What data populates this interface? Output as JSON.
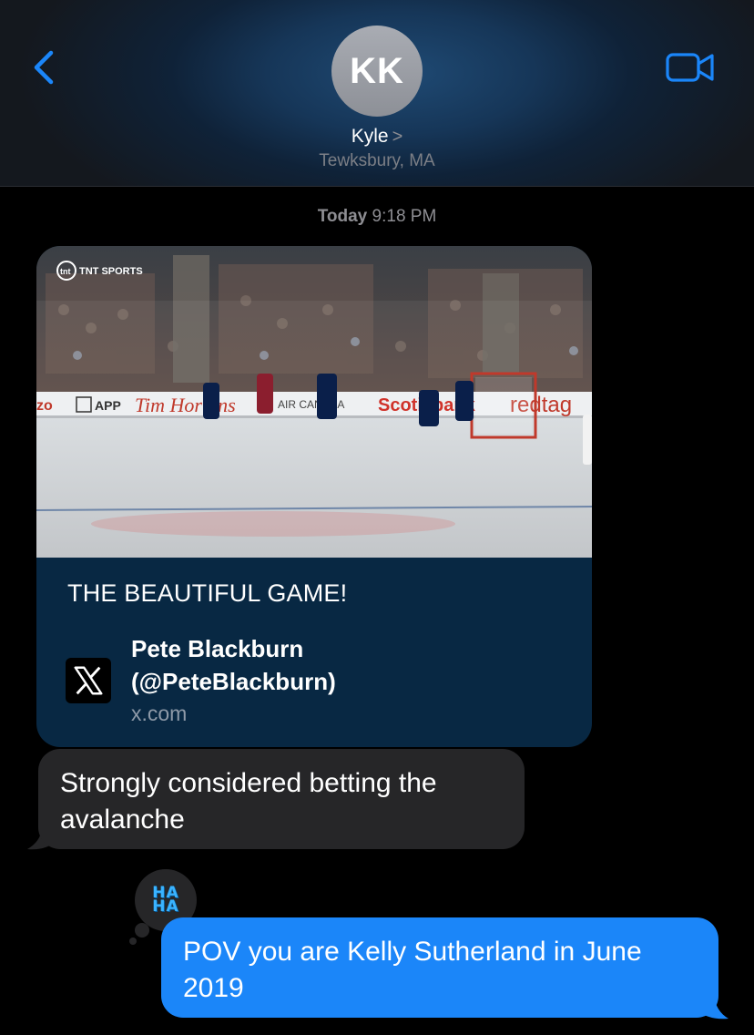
{
  "header": {
    "avatar_initials": "KK",
    "contact_name": "Kyle",
    "contact_chevron": ">",
    "contact_location": "Tewksbury, MA",
    "back_icon": "chevron-left-icon",
    "video_icon": "video-camera-icon",
    "accent_color": "#1b86f9"
  },
  "timestamp": {
    "day": "Today",
    "time": "9:18 PM"
  },
  "link_preview": {
    "broadcaster_logo": "TNT SPORTS",
    "rink_ads": [
      "APP",
      "Tim Hortons",
      "AIR CANADA",
      "Scotiabank",
      "redtag"
    ],
    "title": "THE BEAUTIFUL GAME!",
    "author_name": "Pete Blackburn",
    "author_handle": "(@PeteBlackburn)",
    "domain": "x.com",
    "source_icon": "x-logo-icon"
  },
  "messages": {
    "received_text": "Strongly considered betting the avalanche",
    "tapback_text": "HA HA",
    "sent_text": "POV you are Kelly Sutherland in June 2019",
    "received_color": "#262628",
    "sent_color": "#1b86f9"
  }
}
